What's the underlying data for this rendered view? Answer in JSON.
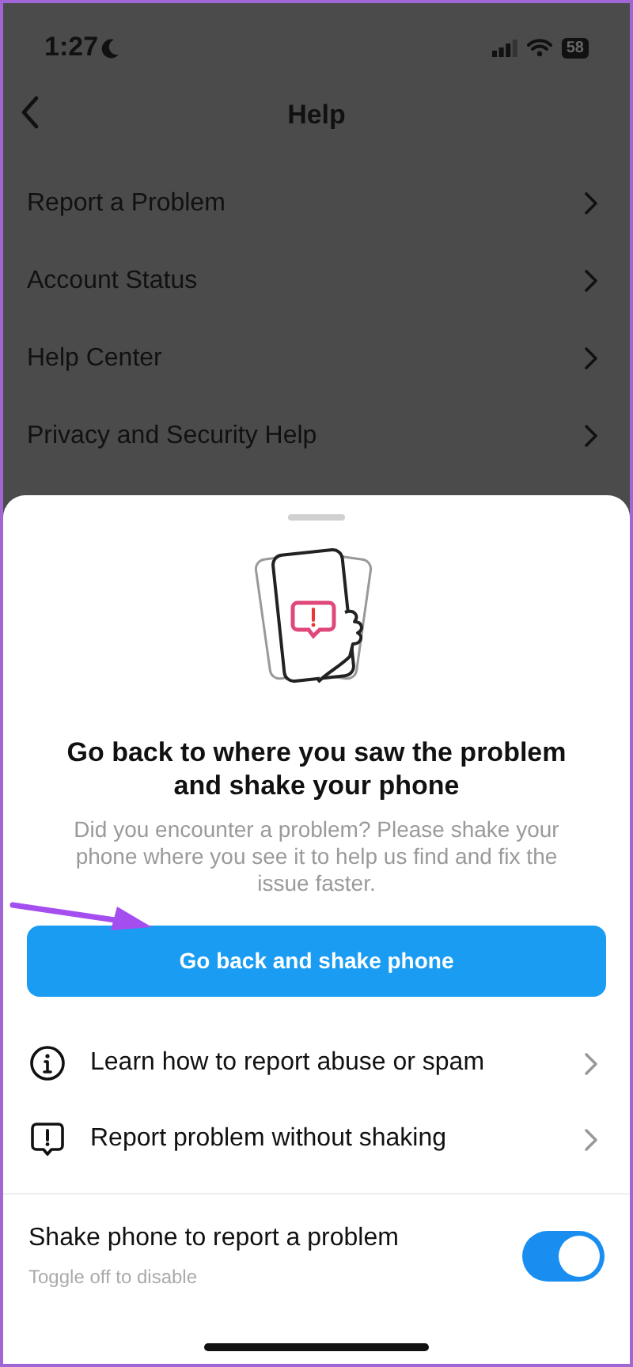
{
  "status_bar": {
    "time": "1:27",
    "battery": "58"
  },
  "header": {
    "title": "Help"
  },
  "menu": [
    {
      "label": "Report a Problem"
    },
    {
      "label": "Account Status"
    },
    {
      "label": "Help Center"
    },
    {
      "label": "Privacy and Security Help"
    }
  ],
  "sheet": {
    "title": "Go back to where you saw the problem and shake your phone",
    "description": "Did you encounter a problem? Please shake your phone where you see it to help us find and fix the issue faster.",
    "primary_button": "Go back and shake phone",
    "options": [
      {
        "kind": "info",
        "label": "Learn how to report abuse or spam"
      },
      {
        "kind": "alert",
        "label": "Report problem without shaking"
      }
    ],
    "toggle": {
      "label": "Shake phone to report a problem",
      "hint": "Toggle off to disable",
      "on": true
    }
  }
}
